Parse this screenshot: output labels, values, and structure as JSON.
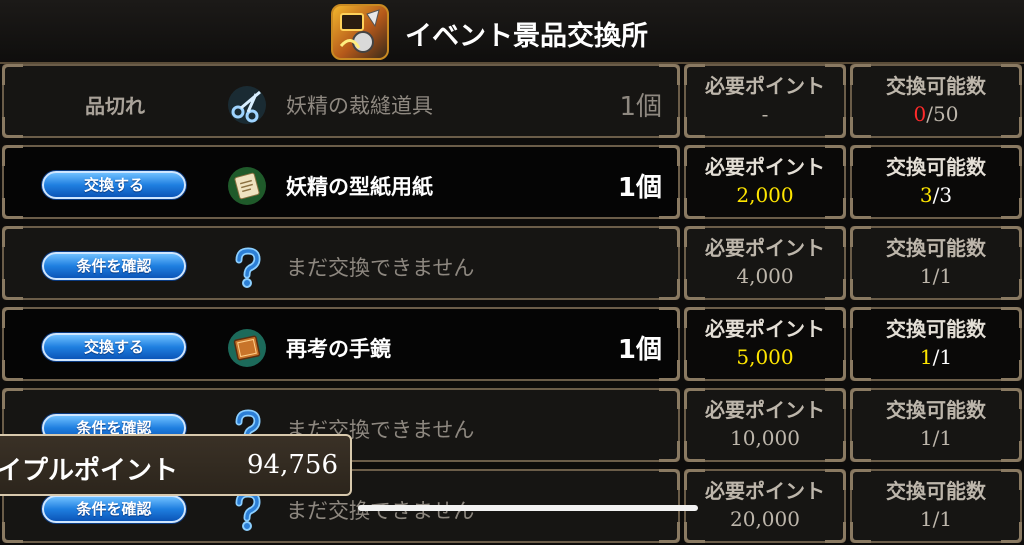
{
  "header": {
    "title": "イベント景品交換所",
    "icon": "event-exchange-icon"
  },
  "labels": {
    "points_label": "必要ポイント",
    "limit_label": "交換可能数"
  },
  "rows": [
    {
      "action_type": "status",
      "action_label": "品切れ",
      "icon": "scissors-icon",
      "name": "妖精の裁縫道具",
      "qty": "1個",
      "dim": true,
      "points": "-",
      "limit_used": "0",
      "limit_total": "/50",
      "limit_color": "red"
    },
    {
      "action_type": "button",
      "action_label": "交換する",
      "icon": "pattern-paper-icon",
      "name": "妖精の型紙用紙",
      "qty": "1個",
      "dim": false,
      "points": "2,000",
      "limit_used": "3",
      "limit_total": "/3",
      "limit_color": "yellow"
    },
    {
      "action_type": "button",
      "action_label": "条件を確認",
      "icon": "question-icon",
      "name": "まだ交換できません",
      "qty": "",
      "dim": true,
      "points": "4,000",
      "limit_used": "1",
      "limit_total": "/1",
      "limit_color": ""
    },
    {
      "action_type": "button",
      "action_label": "交換する",
      "icon": "book-icon",
      "name": "再考の手鏡",
      "qty": "1個",
      "dim": false,
      "points": "5,000",
      "limit_used": "1",
      "limit_total": "/1",
      "limit_color": "yellow"
    },
    {
      "action_type": "button",
      "action_label": "条件を確認",
      "icon": "question-icon",
      "name": "まだ交換できません",
      "qty": "",
      "dim": true,
      "points": "10,000",
      "limit_used": "1",
      "limit_total": "/1",
      "limit_color": ""
    },
    {
      "action_type": "button",
      "action_label": "条件を確認",
      "icon": "question-icon",
      "name": "まだ交換できません",
      "qty": "",
      "dim": true,
      "points": "20,000",
      "limit_used": "1",
      "limit_total": "/1",
      "limit_color": ""
    }
  ],
  "balance": {
    "label": "イプルポイント",
    "value": "94,756"
  },
  "colors": {
    "accent_yellow": "#ffe600",
    "accent_red": "#ff2a2a",
    "button_blue": "#1f7fe0"
  }
}
